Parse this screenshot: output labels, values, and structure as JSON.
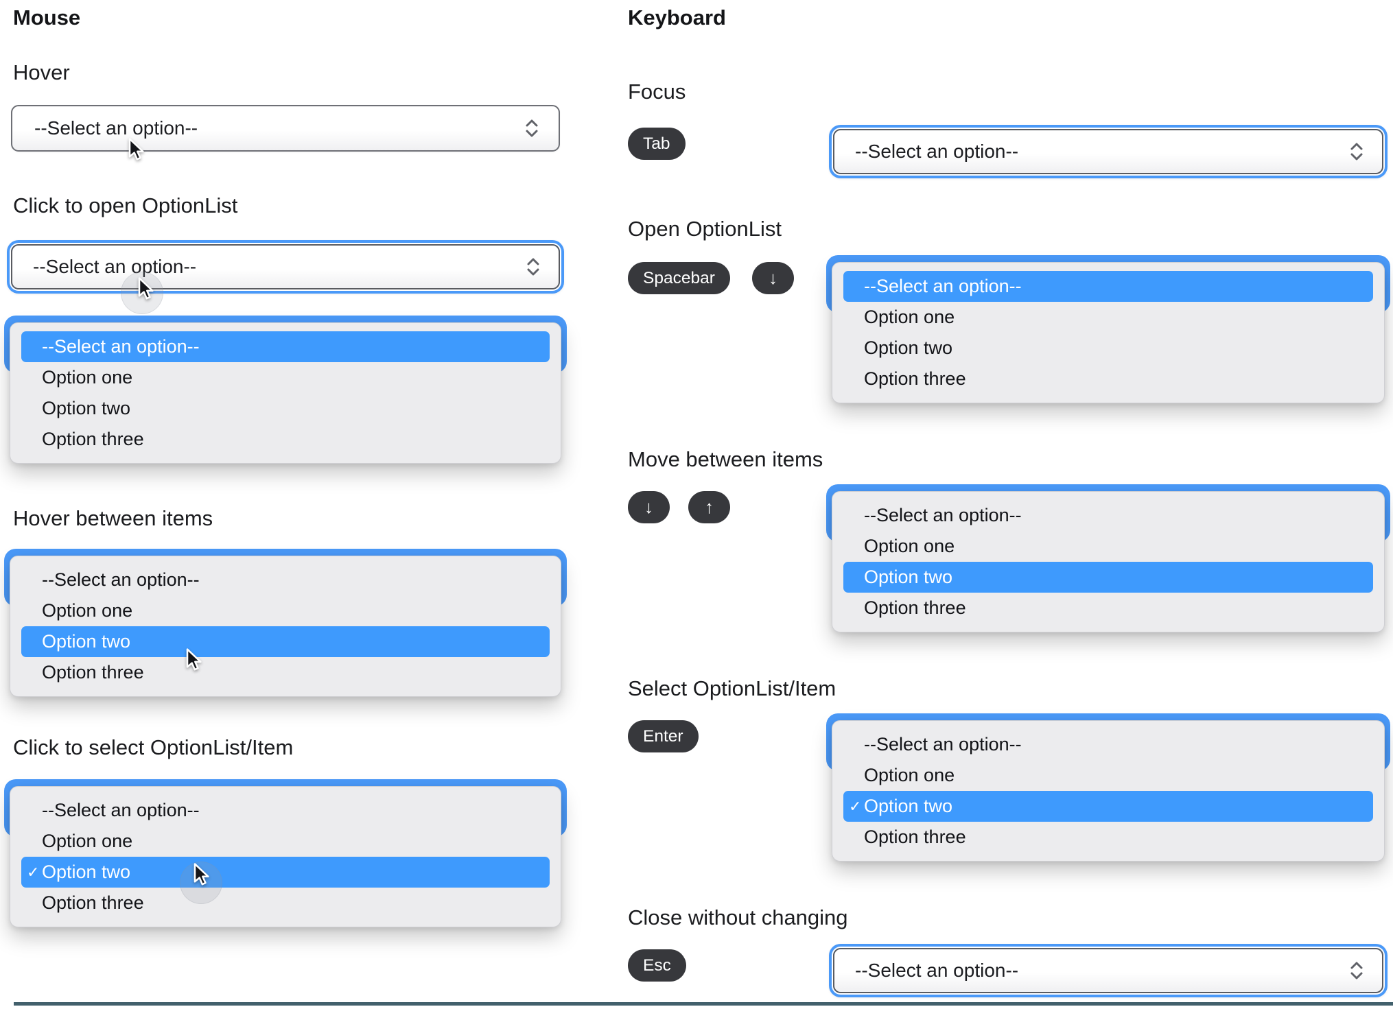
{
  "mouse": {
    "title": "Mouse",
    "hover": {
      "label": "Hover"
    },
    "click_open": {
      "label": "Click to open OptionList"
    },
    "hover_items": {
      "label": "Hover between items"
    },
    "click_select": {
      "label": "Click to select OptionList/Item"
    }
  },
  "keyboard": {
    "title": "Keyboard",
    "focus": {
      "label": "Focus",
      "key": "Tab"
    },
    "open": {
      "label": "Open OptionList",
      "keys": [
        "Spacebar",
        "↓"
      ]
    },
    "move": {
      "label": "Move between items",
      "keys": [
        "↓",
        "↑"
      ]
    },
    "select": {
      "label": "Select OptionList/Item",
      "key": "Enter"
    },
    "close": {
      "label": "Close without changing",
      "key": "Esc"
    }
  },
  "select_control": {
    "placeholder": "--Select an option--",
    "options": [
      "--Select an option--",
      "Option one",
      "Option two",
      "Option three"
    ],
    "selected_check": "✓"
  },
  "colors": {
    "focus_ring": "#4a99f8",
    "highlight": "#3e9afd",
    "key_pill": "#37383c",
    "divider": "#42606c"
  }
}
